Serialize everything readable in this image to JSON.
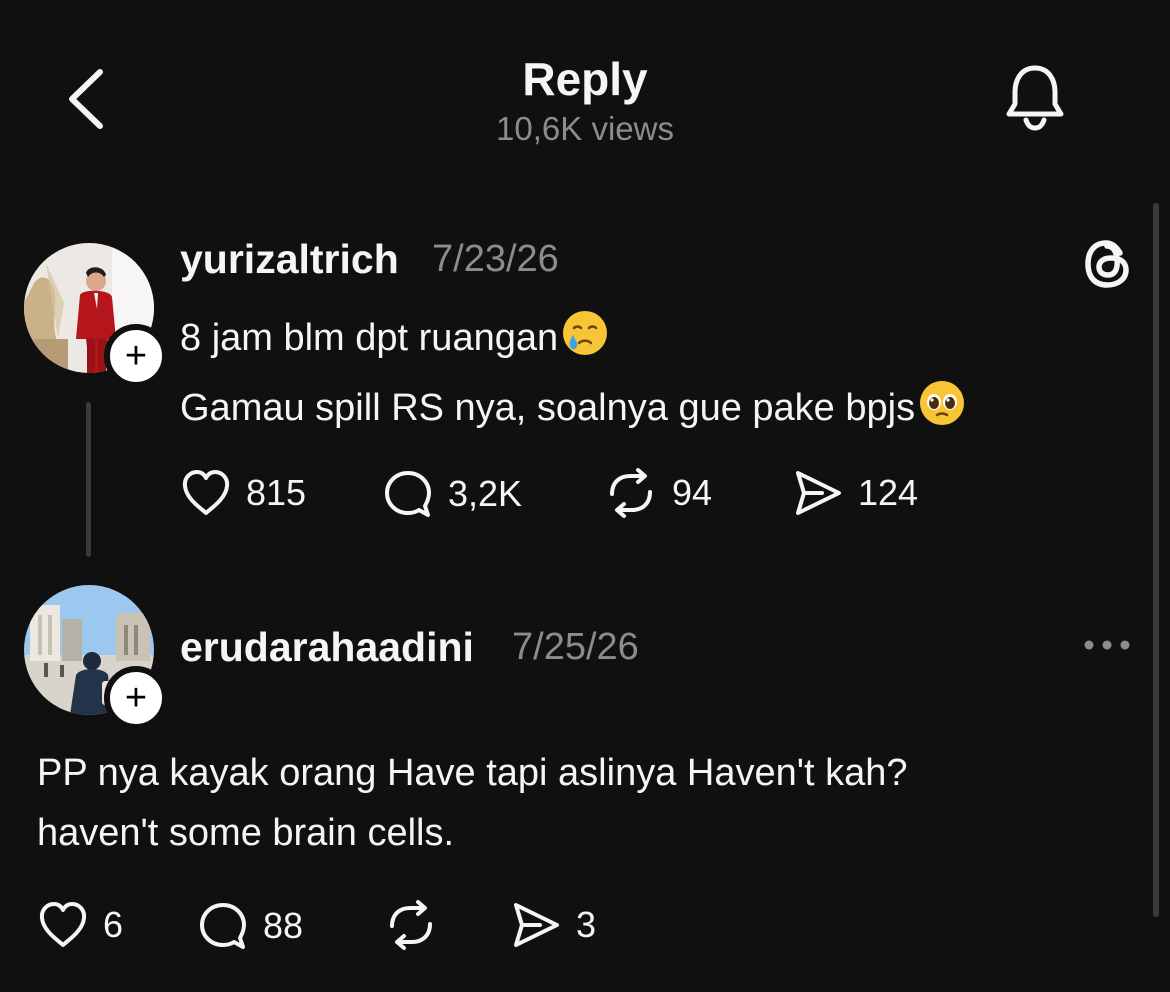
{
  "header": {
    "title": "Reply",
    "views": "10,6K views"
  },
  "icons": {
    "back": "chevron-left-icon",
    "notifications": "bell-icon",
    "app": "threads-logo-icon",
    "more": "more-horizontal-icon"
  },
  "posts": [
    {
      "username": "yurizaltrich",
      "date": "7/23/26",
      "text_lines": [
        "8 jam blm dpt ruangan",
        "Gamau spill RS nya, soalnya gue pake bpjs"
      ],
      "line_emojis": [
        "face-holding-back-tears",
        "pleading-face"
      ],
      "stats": {
        "likes": "815",
        "replies": "3,2K",
        "reposts": "94",
        "shares": "124"
      }
    },
    {
      "username": "erudarahaadini",
      "date": "7/25/26",
      "text_lines": [
        "PP nya kayak orang Have tapi aslinya Haven't kah?",
        "haven't some brain cells."
      ],
      "stats": {
        "likes": "6",
        "replies": "88",
        "reposts": "",
        "shares": "3"
      }
    }
  ],
  "colors": {
    "background": "#101010",
    "text_primary": "#f3f5f7",
    "text_secondary": "#8c8c8c",
    "emoji_yellow": "#f7c536"
  }
}
